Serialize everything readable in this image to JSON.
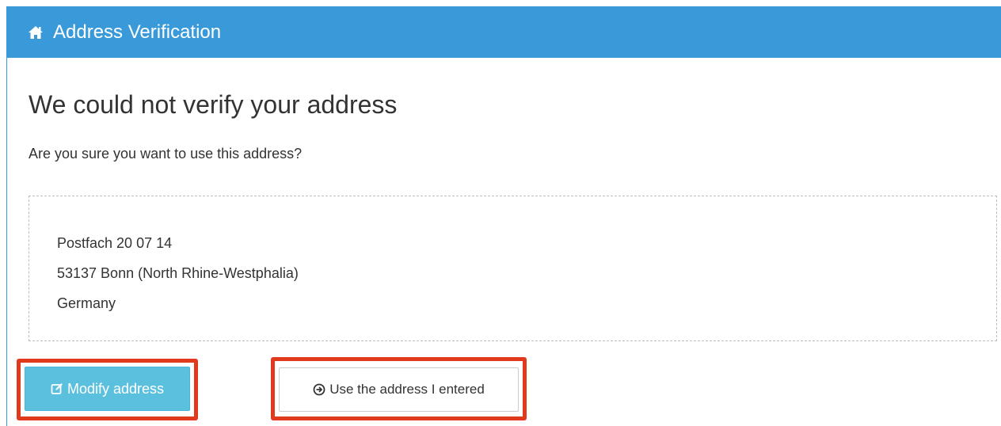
{
  "header": {
    "icon": "home-icon",
    "title": "Address Verification"
  },
  "main": {
    "heading": "We could not verify your address",
    "question": "Are you sure you want to use this address?",
    "address": {
      "line1": "Postfach 20 07 14",
      "line2": "53137 Bonn (North Rhine-Westphalia)",
      "line3": "Germany"
    }
  },
  "actions": {
    "modify": {
      "label": "Modify address",
      "icon": "edit-icon"
    },
    "use_entered": {
      "label": "Use the address I entered",
      "icon": "circle-arrow-right-icon"
    }
  },
  "colors": {
    "header_bg": "#3a9ad9",
    "modify_bg": "#5bc0de",
    "highlight": "#e0391c"
  }
}
